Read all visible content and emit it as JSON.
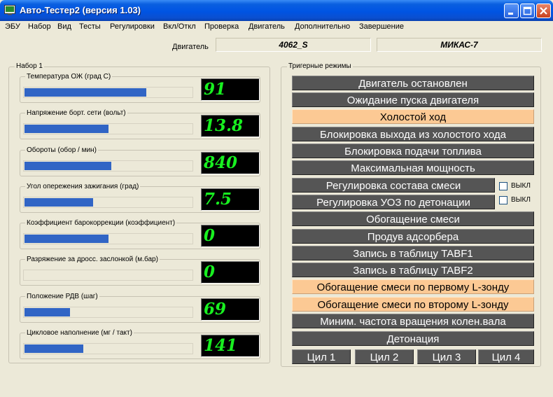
{
  "window": {
    "title": "Авто-Тестер2  (версия 1.03)"
  },
  "menu": [
    "ЭБУ",
    "Набор",
    "Вид",
    "Тесты",
    "Регулировки",
    "Вкл/Откл",
    "Проверка",
    "Двигатель",
    "Дополнительно",
    "Завершение"
  ],
  "engine": {
    "label": "Двигатель",
    "model": "4062_S",
    "ecu": "МИКАС-7"
  },
  "set1": {
    "title": "Набор 1",
    "sensors": [
      {
        "label": "Температура  ОЖ (град С)",
        "value": "91",
        "level": 0.73
      },
      {
        "label": "Напряжение борт. сети  (вольт)",
        "value": "13.8",
        "level": 0.5
      },
      {
        "label": "Обороты  (обор / мин)",
        "value": "840",
        "level": 0.52
      },
      {
        "label": "Угол опережения зажигания  (град)",
        "value": "7.5",
        "level": 0.41
      },
      {
        "label": "Коэффициент барокоррекции  (коэффициент)",
        "value": "0",
        "level": 0.5
      },
      {
        "label": "Разряжение за дросс. заслонкой  (м.бар)",
        "value": "0",
        "level": 0.0
      },
      {
        "label": "Положение РДВ  (шаг)",
        "value": "69",
        "level": 0.27
      },
      {
        "label": "Цикловое наполнение  (мг / такт)",
        "value": "141",
        "level": 0.35
      }
    ]
  },
  "triggers": {
    "title": "Тригерные режимы",
    "modes": [
      {
        "label": "Двигатель остановлен",
        "active": false
      },
      {
        "label": "Ожидание пуска двигателя",
        "active": false
      },
      {
        "label": "Холостой ход",
        "active": true
      },
      {
        "label": "Блокировка выхода из холостого хода",
        "active": false
      },
      {
        "label": "Блокировка подачи топлива",
        "active": false
      },
      {
        "label": "Максимальная мощность",
        "active": false
      },
      {
        "label": "Регулировка состава смеси",
        "active": false
      },
      {
        "label": "Регулировка УОЗ по детонации",
        "active": false
      },
      {
        "label": "Обогащение смеси",
        "active": false
      },
      {
        "label": "Продув адсорбера",
        "active": false
      },
      {
        "label": "Запись в таблицу TABF1",
        "active": false
      },
      {
        "label": "Запись в таблицу TABF2",
        "active": false
      },
      {
        "label": "Обогащение смеси по первому L-зонду",
        "active": true
      },
      {
        "label": "Обогащение смеси по второму L-зонду",
        "active": true
      },
      {
        "label": "Миним. частота вращения колен.вала",
        "active": false
      },
      {
        "label": "Детонация",
        "active": false
      }
    ],
    "checkboxes": [
      {
        "label": "ВЫКЛ",
        "checked": false
      },
      {
        "label": "ВЫКЛ",
        "checked": false
      }
    ],
    "cylinders": [
      "Цил 1",
      "Цил 2",
      "Цил 3",
      "Цил 4"
    ]
  },
  "colors": {
    "active_mode": "#fcc994",
    "inactive_mode": "#555555",
    "lcd_text": "#18f020",
    "bar": "#3165c5"
  }
}
